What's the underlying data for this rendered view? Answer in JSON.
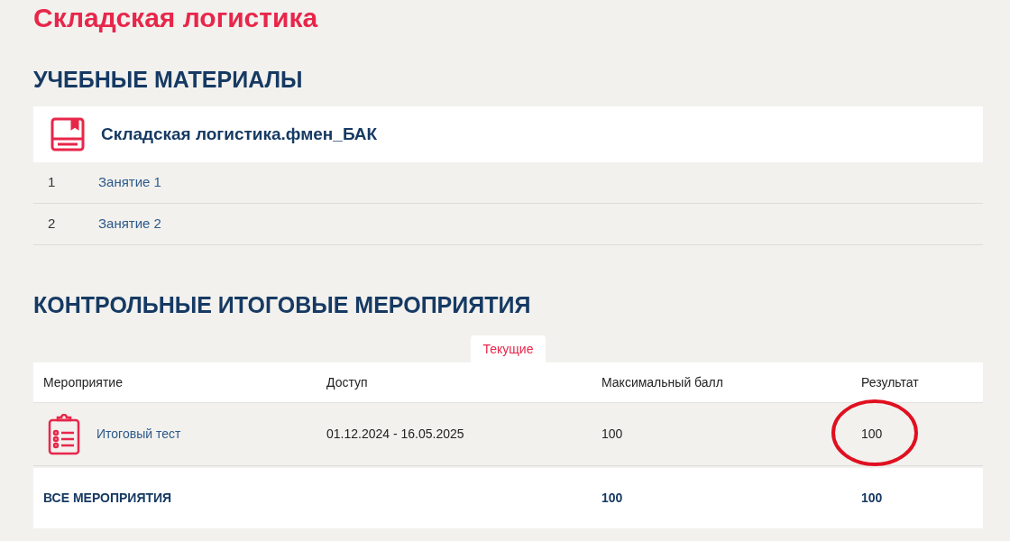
{
  "page_title": "Складская логистика",
  "materials": {
    "heading": "УЧЕБНЫЕ МАТЕРИАЛЫ",
    "course": "Складская логистика.фмен_БАК",
    "lessons": [
      {
        "number": "1",
        "title": "Занятие 1"
      },
      {
        "number": "2",
        "title": "Занятие 2"
      }
    ]
  },
  "events": {
    "heading": "КОНТРОЛЬНЫЕ ИТОГОВЫЕ МЕРОПРИЯТИЯ",
    "tabs": [
      {
        "label": "Текущие",
        "selected": true
      }
    ],
    "columns": [
      "Мероприятие",
      "Доступ",
      "Максимальный балл",
      "Результат"
    ],
    "rows": [
      {
        "name": "Итоговый тест",
        "access": "01.12.2024 - 16.05.2025",
        "max_score": "100",
        "result": "100",
        "result_circled": true
      }
    ],
    "total": {
      "label": "ВСЕ МЕРОПРИЯТИЯ",
      "max_score": "100",
      "result": "100"
    }
  }
}
